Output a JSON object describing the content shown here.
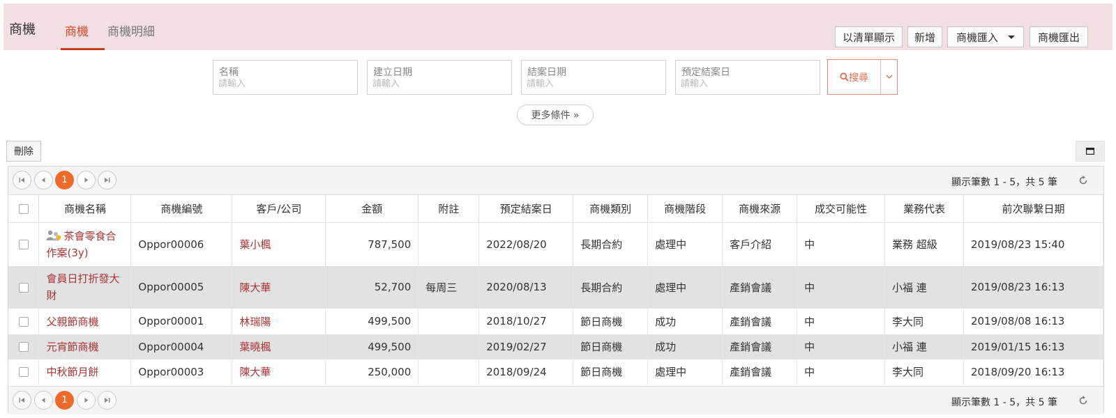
{
  "header": {
    "app_title": "商機",
    "tabs": [
      {
        "label": "商機"
      },
      {
        "label": "商機明細"
      }
    ],
    "buttons": {
      "list_view": "以清單顯示",
      "add": "新增",
      "import": "商機匯入",
      "export": "商機匯出"
    }
  },
  "filters": {
    "fields": [
      {
        "label": "名稱",
        "placeholder": "請輸入"
      },
      {
        "label": "建立日期",
        "placeholder": "請輸入"
      },
      {
        "label": "結案日期",
        "placeholder": "請輸入"
      },
      {
        "label": "預定結案日",
        "placeholder": "請輸入"
      }
    ],
    "search_label": "搜尋",
    "more_label": "更多條件 »"
  },
  "toolbar": {
    "delete_label": "刪除"
  },
  "pager": {
    "current_page": "1",
    "info": "顯示筆數 1 - 5，共 5 筆"
  },
  "table": {
    "columns": [
      "商機名稱",
      "商機編號",
      "客戶/公司",
      "金額",
      "附註",
      "預定結案日",
      "商機類別",
      "商機階段",
      "商機來源",
      "成交可能性",
      "業務代表",
      "前次聯繫日期"
    ],
    "rows": [
      {
        "name": "茶會零食合作案(3y)",
        "code": "Oppor00006",
        "customer": "葉小楓",
        "amount": "787,500",
        "note": "",
        "due": "2022/08/20",
        "category": "長期合約",
        "stage": "處理中",
        "source": "客戶介紹",
        "probability": "中",
        "rep": "業務 超級",
        "last_contact": "2019/08/23 15:40"
      },
      {
        "name": "會員日打折發大財",
        "code": "Oppor00005",
        "customer": "陳大華",
        "amount": "52,700",
        "note": "每周三",
        "due": "2020/08/13",
        "category": "長期合約",
        "stage": "處理中",
        "source": "產銷會議",
        "probability": "中",
        "rep": "小福 連",
        "last_contact": "2019/08/23 16:13"
      },
      {
        "name": "父親節商機",
        "code": "Oppor00001",
        "customer": "林瑞陽",
        "amount": "499,500",
        "note": "",
        "due": "2018/10/27",
        "category": "節日商機",
        "stage": "成功",
        "source": "產銷會議",
        "probability": "中",
        "rep": "李大同",
        "last_contact": "2019/08/08 16:13"
      },
      {
        "name": "元宵節商機",
        "code": "Oppor00004",
        "customer": "葉曉楓",
        "amount": "499,500",
        "note": "",
        "due": "2019/02/27",
        "category": "節日商機",
        "stage": "成功",
        "source": "產銷會議",
        "probability": "中",
        "rep": "小福 連",
        "last_contact": "2019/01/15 16:13"
      },
      {
        "name": "中秋節月餅",
        "code": "Oppor00003",
        "customer": "陳大華",
        "amount": "250,000",
        "note": "",
        "due": "2018/09/24",
        "category": "節日商機",
        "stage": "處理中",
        "source": "產銷會議",
        "probability": "中",
        "rep": "李大同",
        "last_contact": "2018/09/20 16:13"
      }
    ]
  }
}
